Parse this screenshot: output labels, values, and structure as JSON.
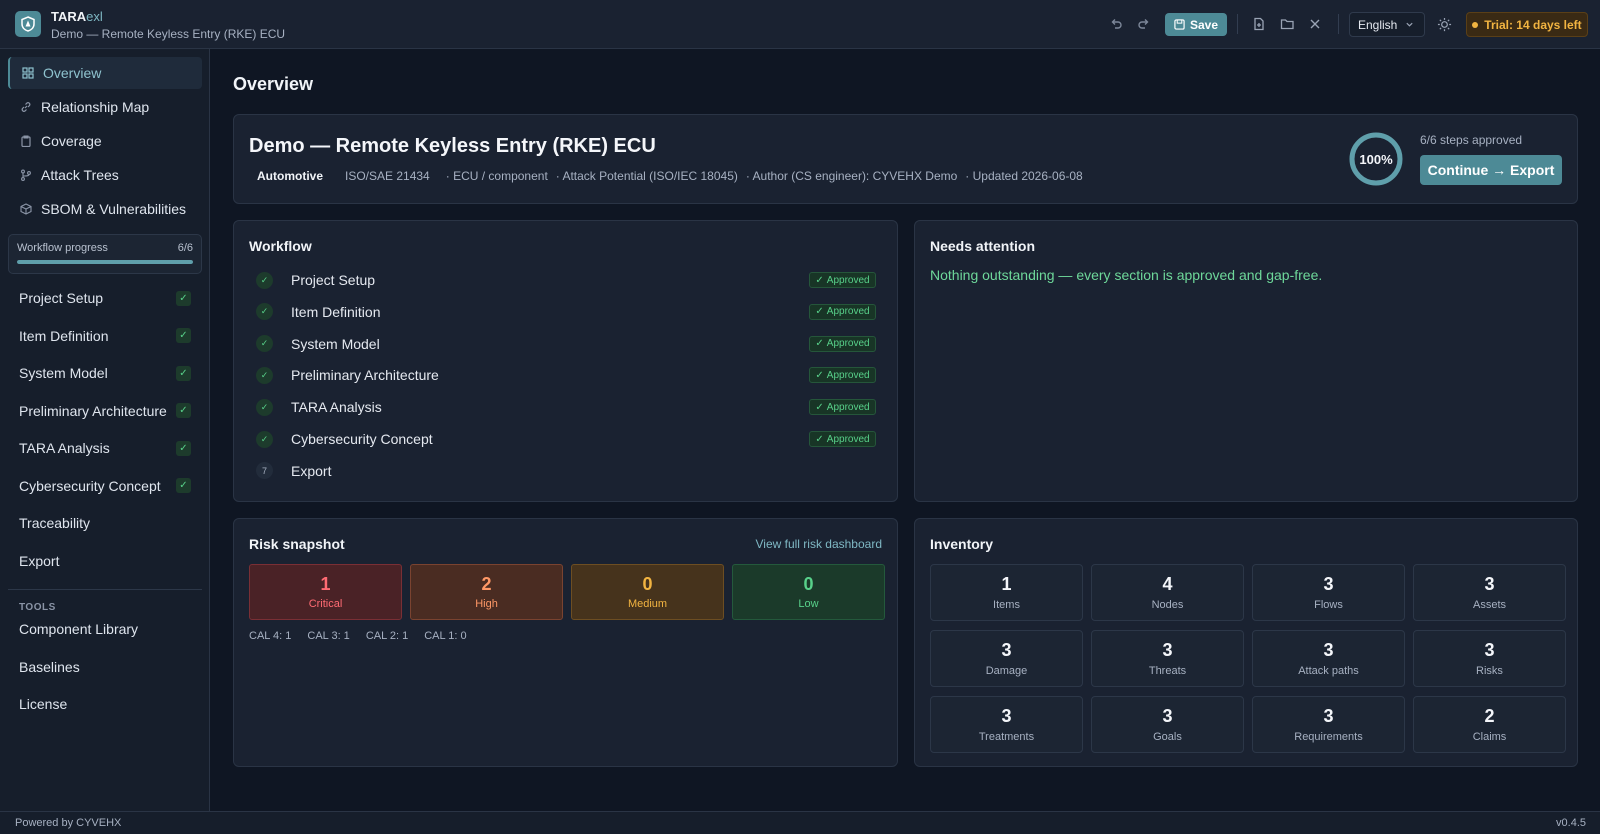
{
  "header": {
    "app_name_a": "TARA",
    "app_name_b": "exl",
    "project_subtitle": "Demo — Remote Keyless Entry (RKE) ECU",
    "save_label": "Save",
    "language": "English",
    "trial": "Trial: 14 days left",
    "icons": [
      "undo-icon",
      "redo-icon",
      "save-icon",
      "new-file-icon",
      "open-folder-icon",
      "close-icon",
      "chevron-down-icon",
      "theme-icon"
    ]
  },
  "sidebar": {
    "nav": [
      {
        "label": "Overview",
        "icon": "grid-icon"
      },
      {
        "label": "Relationship Map",
        "icon": "link-icon"
      },
      {
        "label": "Coverage",
        "icon": "clipboard-icon"
      },
      {
        "label": "Attack Trees",
        "icon": "tree-icon"
      },
      {
        "label": "SBOM & Vulnerabilities",
        "icon": "package-icon"
      }
    ],
    "progress_label": "Workflow progress",
    "progress_value": "6/6",
    "progress_fraction": 1.0,
    "steps": [
      {
        "label": "Project Setup",
        "done": true
      },
      {
        "label": "Item Definition",
        "done": true
      },
      {
        "label": "System Model",
        "done": true
      },
      {
        "label": "Preliminary Architecture",
        "done": true
      },
      {
        "label": "TARA Analysis",
        "done": true
      },
      {
        "label": "Cybersecurity Concept",
        "done": true
      },
      {
        "label": "Traceability",
        "done": false
      },
      {
        "label": "Export",
        "done": false
      }
    ],
    "tools_label": "TOOLS",
    "tools": [
      "Component Library",
      "Baselines",
      "License"
    ]
  },
  "main": {
    "page_title": "Overview",
    "project": {
      "title": "Demo — Remote Keyless Entry (RKE) ECU",
      "domain": "Automotive",
      "standard": "ISO/SAE 21434",
      "scope": "· ECU / component",
      "method": "· Attack Potential (ISO/IEC 18045)",
      "author": "· Author (CS engineer): CYVEHX Demo",
      "updated": "· Updated 2026-06-08",
      "completion": "100%",
      "completion_fraction": 1.0,
      "steps_approved": "6/6 steps approved",
      "continue_label": "Continue → Export"
    },
    "workflow": {
      "title": "Workflow",
      "approved_label": "Approved",
      "steps": [
        {
          "label": "Project Setup",
          "approved": true
        },
        {
          "label": "Item Definition",
          "approved": true
        },
        {
          "label": "System Model",
          "approved": true
        },
        {
          "label": "Preliminary Architecture",
          "approved": true
        },
        {
          "label": "TARA Analysis",
          "approved": true
        },
        {
          "label": "Cybersecurity Concept",
          "approved": true
        },
        {
          "label": "Export",
          "approved": false,
          "number": "7"
        }
      ]
    },
    "attention": {
      "title": "Needs attention",
      "message": "Nothing outstanding — every section is approved and gap-free."
    },
    "risk": {
      "title": "Risk snapshot",
      "link": "View full risk dashboard",
      "levels": [
        {
          "value": "1",
          "label": "Critical",
          "bg": "#4a2226",
          "border": "#7a2f35",
          "color": "#ff6b73"
        },
        {
          "value": "2",
          "label": "High",
          "bg": "#4a2c22",
          "border": "#7a4330",
          "color": "#ff9866"
        },
        {
          "value": "0",
          "label": "Medium",
          "bg": "#46331c",
          "border": "#6d4e22",
          "color": "#f2b441"
        },
        {
          "value": "0",
          "label": "Low",
          "bg": "#1b3a2a",
          "border": "#24593c",
          "color": "#58d18a"
        }
      ],
      "cal": [
        "CAL 4: 1",
        "CAL 3: 1",
        "CAL 2: 1",
        "CAL 1: 0"
      ]
    },
    "inventory": {
      "title": "Inventory",
      "items": [
        {
          "value": "1",
          "label": "Items"
        },
        {
          "value": "4",
          "label": "Nodes"
        },
        {
          "value": "3",
          "label": "Flows"
        },
        {
          "value": "3",
          "label": "Assets"
        },
        {
          "value": "3",
          "label": "Damage"
        },
        {
          "value": "3",
          "label": "Threats"
        },
        {
          "value": "3",
          "label": "Attack paths"
        },
        {
          "value": "3",
          "label": "Risks"
        },
        {
          "value": "3",
          "label": "Treatments"
        },
        {
          "value": "3",
          "label": "Goals"
        },
        {
          "value": "3",
          "label": "Requirements"
        },
        {
          "value": "2",
          "label": "Claims"
        }
      ]
    }
  },
  "footer": {
    "powered": "Powered by CYVEHX",
    "version": "v0.4.5"
  }
}
